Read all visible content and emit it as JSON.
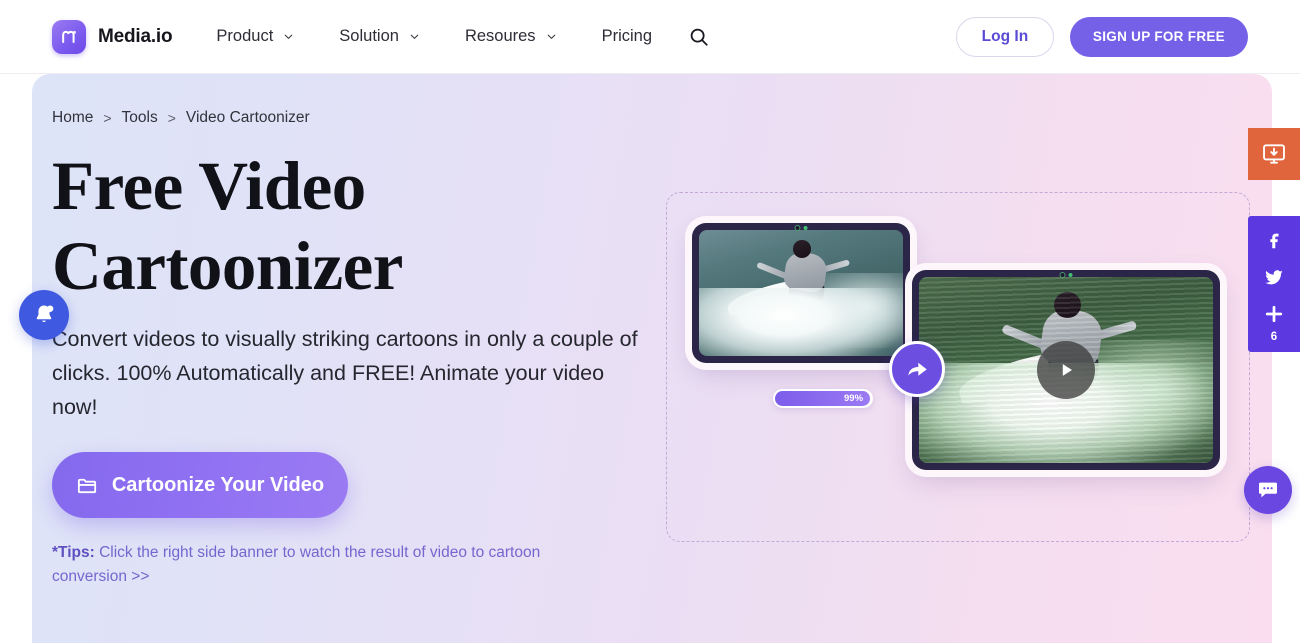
{
  "header": {
    "brand_name": "Media.io",
    "logo_icon": "media-io-logo",
    "nav": [
      {
        "label": "Product",
        "has_dropdown": true,
        "icon": "chevron-down-icon"
      },
      {
        "label": "Solution",
        "has_dropdown": true,
        "icon": "chevron-down-icon"
      },
      {
        "label": "Resoures",
        "has_dropdown": true,
        "icon": "chevron-down-icon"
      },
      {
        "label": "Pricing",
        "has_dropdown": false,
        "icon": ""
      }
    ],
    "search_icon": "search-icon",
    "login_label": "Log In",
    "signup_label": "SIGN UP FOR FREE",
    "accent_color": "#7461e8",
    "login_text_color": "#5b4bd4"
  },
  "hero": {
    "breadcrumb": [
      {
        "label": "Home"
      },
      {
        "label": "Tools"
      },
      {
        "label": "Video Cartoonizer"
      }
    ],
    "breadcrumb_separator": ">",
    "title": "Free Video Cartoonizer",
    "subtitle": "Convert videos to visually striking cartoons in only a couple of clicks. 100% Automatically and FREE! Animate your video now!",
    "cta_label": "Cartoonize Your Video",
    "cta_icon": "folder-open-icon",
    "tips_prefix": "*Tips:",
    "tips_text": "Click the right side banner to watch the result of video to cartoon conversion >>",
    "background_gradient_from": "#dde4f8",
    "background_gradient_to": "#fadeef"
  },
  "media": {
    "original_thumb": {
      "name": "original-video-thumbnail",
      "alt": "Surfer riding a wave, original footage"
    },
    "cartoon_thumb": {
      "name": "cartoonized-video-thumbnail",
      "alt": "Surfer riding a wave, cartoonized result"
    },
    "convert_icon": "share-arrow-icon",
    "play_icon": "play-icon",
    "progress_label": "99%",
    "progress_value": 99,
    "progress_fill_color": "#7d5ceb"
  },
  "widgets": {
    "notification_icon": "notification-bell-icon",
    "download_icon": "monitor-download-icon",
    "download_color": "#e0653c",
    "social_panel_color": "#5b38e0",
    "social": [
      {
        "icon": "facebook-icon",
        "label": "Facebook"
      },
      {
        "icon": "twitter-icon",
        "label": "Twitter"
      },
      {
        "icon": "plus-icon",
        "label": "More"
      }
    ],
    "social_count": "6",
    "chat_icon": "chat-bubble-icon",
    "chat_color": "#6a47e0"
  }
}
